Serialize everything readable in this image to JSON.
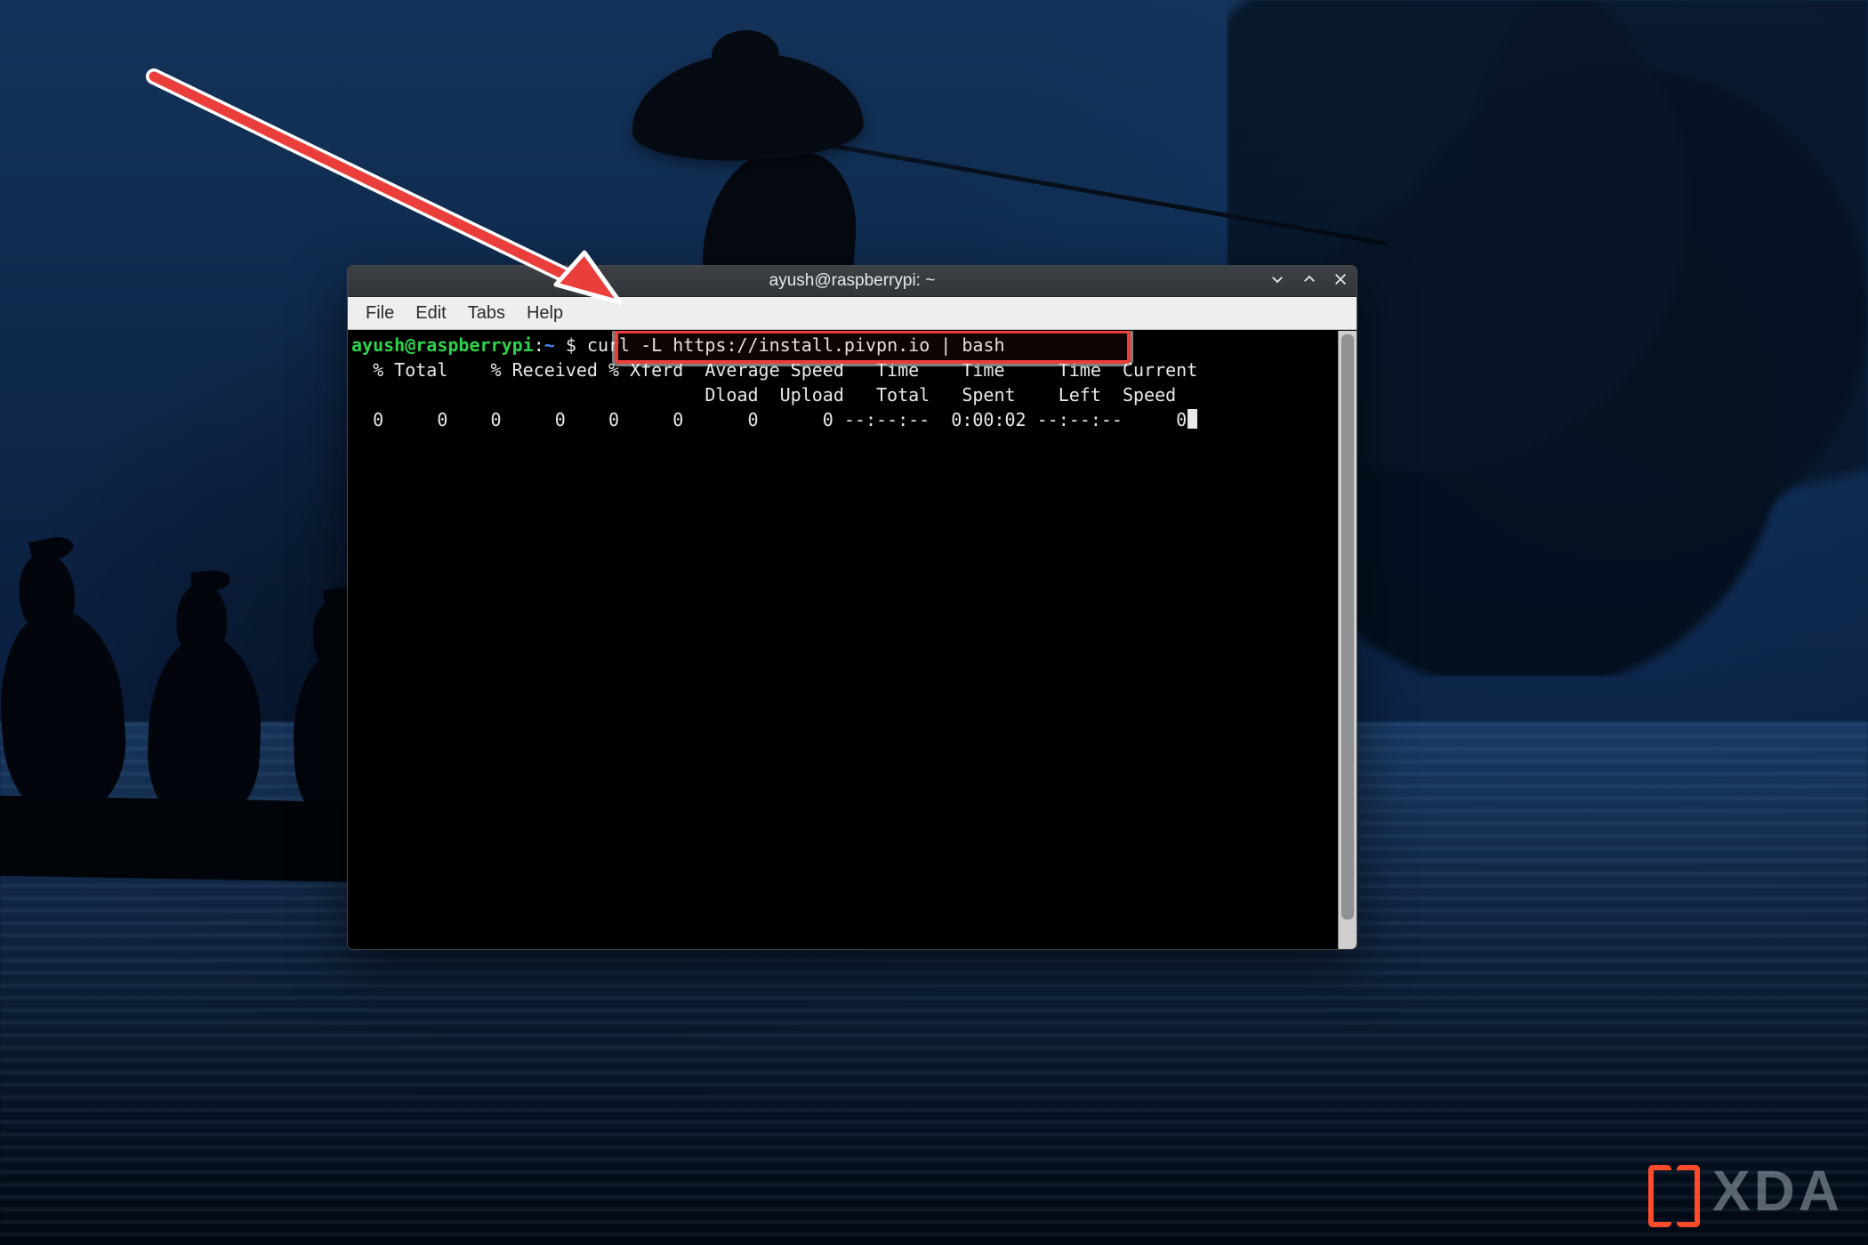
{
  "window": {
    "title": "ayush@raspberrypi: ~",
    "controls": {
      "minimize_name": "minimize-icon",
      "maximize_name": "maximize-icon",
      "close_name": "close-icon"
    }
  },
  "menubar": {
    "items": [
      "File",
      "Edit",
      "Tabs",
      "Help"
    ]
  },
  "prompt": {
    "user_host": "ayush@raspberrypi",
    "separator": ":",
    "path": "~",
    "sigil": " $ ",
    "command": "curl -L https://install.pivpn.io | bash"
  },
  "curl_output": {
    "header1": "  % Total    % Received % Xferd  Average Speed   Time    Time     Time  Current",
    "header2": "                                 Dload  Upload   Total   Spent    Left  Speed",
    "row": "  0     0    0     0    0     0      0      0 --:--:--  0:00:02 --:--:--     0"
  },
  "watermark": {
    "text": "XDA"
  },
  "colors": {
    "accent_red": "#ea3e3b",
    "prompt_green": "#2fd24a",
    "path_blue": "#4a86ff"
  }
}
